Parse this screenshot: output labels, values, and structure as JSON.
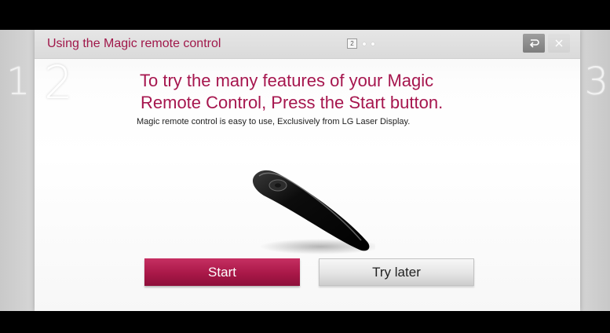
{
  "dialog": {
    "title": "Using the Magic remote control",
    "pager": {
      "current": "2",
      "dots": 2
    },
    "step_number": "2",
    "prev_step": "1",
    "next_step": "3",
    "headline_line1": "To try the many features of your Magic",
    "headline_line2": "Remote Control, Press the Start button.",
    "subtext": "Magic remote control is easy to use, Exclusively from LG Laser Display.",
    "buttons": {
      "start": "Start",
      "try_later": "Try later"
    },
    "icons": {
      "back": "back-arrow-icon",
      "close": "close-icon",
      "illustration": "magic-remote-illustration"
    }
  },
  "colors": {
    "accent": "#a6164e",
    "start_button": "#a91848",
    "background": "#000000"
  }
}
